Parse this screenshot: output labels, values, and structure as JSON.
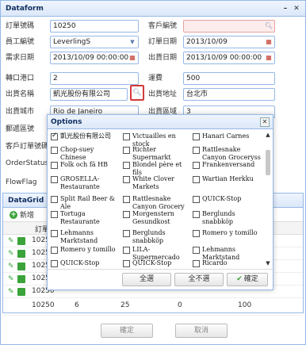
{
  "window": {
    "title": "Dataform"
  },
  "form": {
    "rows": [
      {
        "left_label": "訂單號碼",
        "left_value": "10250",
        "right_label": "客戶編號",
        "right_value": ""
      },
      {
        "left_label": "員工編號",
        "left_value": "LeverlingS",
        "right_label": "訂單日期",
        "right_value": "2013/10/09"
      },
      {
        "left_label": "需求日期",
        "left_value": "2013/10/09 00:00:00",
        "right_label": "出貨日期",
        "right_value": "2013/10/09 00:00:00"
      },
      {
        "left_label": "轉口港口",
        "left_value": "2",
        "right_label": "運費",
        "right_value": "500"
      },
      {
        "left_label": "出貨名稱",
        "left_value": "凱光股份有限公司",
        "right_label": "出貨地址",
        "right_value": "台北市"
      },
      {
        "left_label": "出貨城市",
        "left_value": "Rio de Janeiro",
        "right_label": "出貨區域",
        "right_value": "3"
      },
      {
        "left_label": "郵遞區號",
        "left_value": "",
        "right_label": "",
        "right_value": ""
      },
      {
        "left_label": "客戶訂單號碼",
        "left_value": "",
        "right_label": "",
        "right_value": ""
      }
    ],
    "extra_labels": [
      "OrderStatus",
      "FlowFlag"
    ]
  },
  "grid": {
    "title": "DataGrid",
    "add_label": "新增",
    "header": "訂單號...",
    "rows": [
      {
        "id": "10250"
      },
      {
        "id": "10250"
      },
      {
        "id": "10250"
      },
      {
        "id": "10250"
      },
      {
        "id": "10250"
      },
      {
        "id": "10250",
        "c2": "6",
        "c3": "25",
        "c4": "0",
        "c5": "100"
      }
    ]
  },
  "footer": {
    "ok": "確定",
    "cancel": "取消"
  },
  "options": {
    "title": "Options",
    "items": [
      {
        "label": "凱光股份有限公司",
        "checked": true
      },
      {
        "label": "Victuailles en stock",
        "checked": false
      },
      {
        "label": "Hanari Carnes",
        "checked": false
      },
      {
        "label": "Chop-suey Chinese",
        "checked": false
      },
      {
        "label": "Richter Supermarkt",
        "checked": false
      },
      {
        "label": "Rattlesnake Canyon Groceryss",
        "checked": false
      },
      {
        "label": "Folk och fä HB",
        "checked": false
      },
      {
        "label": "Blondel père et fils",
        "checked": false
      },
      {
        "label": "Frankenversand",
        "checked": false
      },
      {
        "label": "GROSELLA-Restaurante",
        "checked": false
      },
      {
        "label": "White Clover Markets",
        "checked": false
      },
      {
        "label": "Wartian Herkku",
        "checked": false
      },
      {
        "label": "Split Rail Beer & Ale",
        "checked": false
      },
      {
        "label": "Rattlesnake Canyon Grocery",
        "checked": false
      },
      {
        "label": "QUICK-Stop",
        "checked": false
      },
      {
        "label": "Tortuga Restaurante",
        "checked": false
      },
      {
        "label": "Morgenstern Gesundkost",
        "checked": false
      },
      {
        "label": "Berglunds snabbköp",
        "checked": false
      },
      {
        "label": "Lehmanns Marktstand",
        "checked": false
      },
      {
        "label": "Berglunds snabbköp",
        "checked": false
      },
      {
        "label": "Romero y tomillo",
        "checked": false
      },
      {
        "label": "Romero y tomillo",
        "checked": false
      },
      {
        "label": "LILA-Supermercado",
        "checked": false
      },
      {
        "label": "Lehmanns Marktstand",
        "checked": false
      },
      {
        "label": "QUICK-Stop",
        "checked": false
      },
      {
        "label": "QUICK-Stop",
        "checked": false
      },
      {
        "label": "Ricardo Adocicados",
        "checked": false
      }
    ],
    "select_all": "全選",
    "select_none": "全不選",
    "ok": "確定"
  }
}
